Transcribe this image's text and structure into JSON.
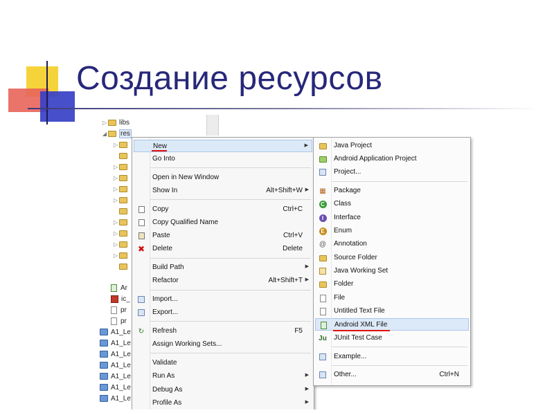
{
  "slide": {
    "title": "Создание ресурсов"
  },
  "colors": {
    "title": "#27277a",
    "highlight": "#dce9f8",
    "underline": "#e01010"
  },
  "tree": [
    {
      "label": "libs",
      "icon": "folder-icon",
      "arrow": "▷"
    },
    {
      "label": "res",
      "icon": "folder-icon",
      "arrow": "◢",
      "selected": true
    },
    {
      "label": "",
      "icon": "folder-icon",
      "arrow": "▷"
    },
    {
      "label": "",
      "icon": "folder-icon",
      "arrow": ""
    },
    {
      "label": "",
      "icon": "folder-icon",
      "arrow": "▷"
    },
    {
      "label": "",
      "icon": "folder-icon",
      "arrow": "▷"
    },
    {
      "label": "",
      "icon": "folder-icon",
      "arrow": "▷"
    },
    {
      "label": "",
      "icon": "folder-icon",
      "arrow": "▷"
    },
    {
      "label": "",
      "icon": "folder-icon",
      "arrow": ""
    },
    {
      "label": "",
      "icon": "folder-icon",
      "arrow": "▷"
    },
    {
      "label": "",
      "icon": "folder-icon",
      "arrow": "▷"
    },
    {
      "label": "",
      "icon": "folder-icon",
      "arrow": "▷"
    },
    {
      "label": "",
      "icon": "folder-icon",
      "arrow": "▷"
    },
    {
      "label": "",
      "icon": "folder-icon",
      "arrow": ""
    },
    {
      "label": "Ar",
      "icon": "xml-file-icon",
      "arrow": ""
    },
    {
      "label": "ic_",
      "icon": "image-file-icon",
      "arrow": ""
    },
    {
      "label": "pr",
      "icon": "file-icon",
      "arrow": ""
    },
    {
      "label": "pr",
      "icon": "file-icon",
      "arrow": ""
    },
    {
      "label": "A1_Le",
      "icon": "project-icon",
      "arrow": ""
    },
    {
      "label": "A1_Le",
      "icon": "project-icon",
      "arrow": ""
    },
    {
      "label": "A1_Le",
      "icon": "project-icon",
      "arrow": ""
    },
    {
      "label": "A1_Le",
      "icon": "project-icon",
      "arrow": ""
    },
    {
      "label": "A1_Le",
      "icon": "project-icon",
      "arrow": ""
    },
    {
      "label": "A1_Le",
      "icon": "project-icon",
      "arrow": ""
    },
    {
      "label": "A1_Le",
      "icon": "project-icon",
      "arrow": ""
    }
  ],
  "context_menu": {
    "items": [
      {
        "label": "New",
        "shortcut": "",
        "submenu": true,
        "icon": ""
      },
      {
        "label": "Go Into",
        "shortcut": "",
        "submenu": false,
        "icon": ""
      },
      {
        "label": "Open in New Window",
        "shortcut": "",
        "submenu": false,
        "icon": ""
      },
      {
        "label": "Show In",
        "shortcut": "Alt+Shift+W",
        "submenu": true,
        "icon": ""
      },
      {
        "label": "Copy",
        "shortcut": "Ctrl+C",
        "submenu": false,
        "icon": "copy-icon"
      },
      {
        "label": "Copy Qualified Name",
        "shortcut": "",
        "submenu": false,
        "icon": "copy-icon"
      },
      {
        "label": "Paste",
        "shortcut": "Ctrl+V",
        "submenu": false,
        "icon": "paste-icon"
      },
      {
        "label": "Delete",
        "shortcut": "Delete",
        "submenu": false,
        "icon": "delete-icon"
      },
      {
        "label": "Build Path",
        "shortcut": "",
        "submenu": true,
        "icon": ""
      },
      {
        "label": "Refactor",
        "shortcut": "Alt+Shift+T",
        "submenu": true,
        "icon": ""
      },
      {
        "label": "Import...",
        "shortcut": "",
        "submenu": false,
        "icon": "import-icon"
      },
      {
        "label": "Export...",
        "shortcut": "",
        "submenu": false,
        "icon": "export-icon"
      },
      {
        "label": "Refresh",
        "shortcut": "F5",
        "submenu": false,
        "icon": "refresh-icon"
      },
      {
        "label": "Assign Working Sets...",
        "shortcut": "",
        "submenu": false,
        "icon": ""
      },
      {
        "label": "Validate",
        "shortcut": "",
        "submenu": false,
        "icon": ""
      },
      {
        "label": "Run As",
        "shortcut": "",
        "submenu": true,
        "icon": ""
      },
      {
        "label": "Debug As",
        "shortcut": "",
        "submenu": true,
        "icon": ""
      },
      {
        "label": "Profile As",
        "shortcut": "",
        "submenu": true,
        "icon": ""
      }
    ]
  },
  "new_submenu": {
    "items": [
      {
        "label": "Java Project",
        "shortcut": "",
        "icon": "java-project-icon"
      },
      {
        "label": "Android Application Project",
        "shortcut": "",
        "icon": "android-project-icon"
      },
      {
        "label": "Project...",
        "shortcut": "",
        "icon": "project-wizard-icon"
      },
      {
        "label": "Package",
        "shortcut": "",
        "icon": "package-icon"
      },
      {
        "label": "Class",
        "shortcut": "",
        "icon": "class-icon"
      },
      {
        "label": "Interface",
        "shortcut": "",
        "icon": "interface-icon"
      },
      {
        "label": "Enum",
        "shortcut": "",
        "icon": "enum-icon"
      },
      {
        "label": "Annotation",
        "shortcut": "",
        "icon": "annotation-icon"
      },
      {
        "label": "Source Folder",
        "shortcut": "",
        "icon": "source-folder-icon"
      },
      {
        "label": "Java Working Set",
        "shortcut": "",
        "icon": "working-set-icon"
      },
      {
        "label": "Folder",
        "shortcut": "",
        "icon": "folder-icon"
      },
      {
        "label": "File",
        "shortcut": "",
        "icon": "file-icon"
      },
      {
        "label": "Untitled Text File",
        "shortcut": "",
        "icon": "text-file-icon"
      },
      {
        "label": "Android XML File",
        "shortcut": "",
        "icon": "android-xml-icon"
      },
      {
        "label": "JUnit Test Case",
        "shortcut": "",
        "icon": "junit-icon"
      },
      {
        "label": "Example...",
        "shortcut": "",
        "icon": "example-icon"
      },
      {
        "label": "Other...",
        "shortcut": "Ctrl+N",
        "icon": "other-icon"
      }
    ]
  }
}
